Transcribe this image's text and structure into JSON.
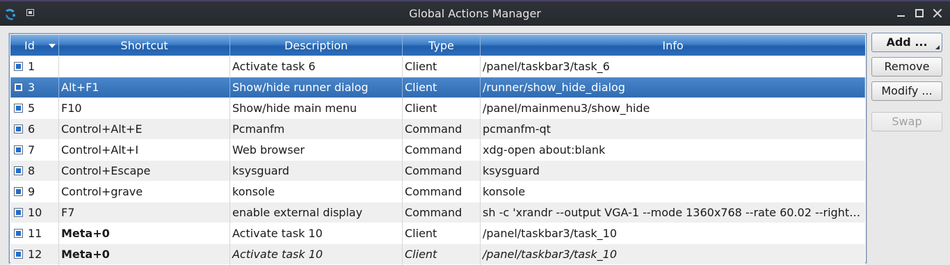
{
  "window": {
    "title": "Global Actions Manager",
    "icons": [
      "app-icon",
      "pin-icon",
      "minimize-icon",
      "maximize-icon",
      "close-icon"
    ]
  },
  "table": {
    "headers": {
      "id": "Id",
      "shortcut": "Shortcut",
      "description": "Description",
      "type": "Type",
      "info": "Info"
    },
    "sort_column": "id",
    "sort_order": "descending-indicator",
    "rows": [
      {
        "id": "1",
        "shortcut": "",
        "description": "Activate task 6",
        "type": "Client",
        "info": "/panel/taskbar3/task_6",
        "checked": true
      },
      {
        "id": "3",
        "shortcut": "Alt+F1",
        "description": "Show/hide runner dialog",
        "type": "Client",
        "info": "/runner/show_hide_dialog",
        "checked": true,
        "selected": true
      },
      {
        "id": "5",
        "shortcut": "F10",
        "description": "Show/hide main menu",
        "type": "Client",
        "info": "/panel/mainmenu3/show_hide",
        "checked": true
      },
      {
        "id": "6",
        "shortcut": "Control+Alt+E",
        "description": "Pcmanfm",
        "type": "Command",
        "info": "pcmanfm-qt",
        "checked": true
      },
      {
        "id": "7",
        "shortcut": "Control+Alt+I",
        "description": "Web browser",
        "type": "Command",
        "info": "xdg-open about:blank",
        "checked": true
      },
      {
        "id": "8",
        "shortcut": "Control+Escape",
        "description": "ksysguard",
        "type": "Command",
        "info": "ksysguard",
        "checked": true
      },
      {
        "id": "9",
        "shortcut": "Control+grave",
        "description": "konsole",
        "type": "Command",
        "info": "konsole",
        "checked": true
      },
      {
        "id": "10",
        "shortcut": "F7",
        "description": "enable external display",
        "type": "Command",
        "info": "sh -c 'xrandr --output VGA-1 --mode 1360x768 --rate 60.02 --right…",
        "checked": true
      },
      {
        "id": "11",
        "shortcut": "Meta+0",
        "description": "Activate task 10",
        "type": "Client",
        "info": "/panel/taskbar3/task_10",
        "checked": true,
        "shortcut_bold": true
      },
      {
        "id": "12",
        "shortcut": "Meta+0",
        "description": "Activate task 10",
        "type": "Client",
        "info": "/panel/taskbar3/task_10",
        "checked": true,
        "shortcut_bold": true,
        "italic": true
      }
    ]
  },
  "buttons": {
    "add": "Add ...",
    "remove": "Remove",
    "modify": "Modify ...",
    "swap": "Swap",
    "swap_enabled": false
  },
  "colors": {
    "header_gradient_top": "#7fb1e6",
    "header_gradient_bottom": "#2d6cb8",
    "selection": "#3a78bd",
    "checkbox_fill": "#1f6fd0",
    "titlebar": "#2b2e33"
  }
}
